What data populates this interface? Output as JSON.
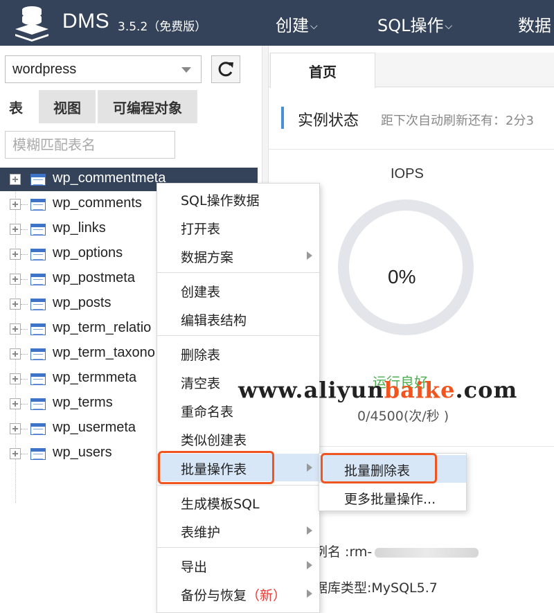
{
  "header": {
    "app_name": "DMS",
    "version": "3.5.2（免费版）",
    "nav": [
      {
        "label": "创建"
      },
      {
        "label": "SQL操作"
      },
      {
        "label": "数据"
      }
    ]
  },
  "left_panel": {
    "database": "wordpress",
    "tabs": [
      {
        "label": "表"
      },
      {
        "label": "视图"
      },
      {
        "label": "可编程对象"
      }
    ],
    "filter_placeholder": "模糊匹配表名",
    "tables": [
      {
        "name": "wp_commentmeta"
      },
      {
        "name": "wp_comments"
      },
      {
        "name": "wp_links"
      },
      {
        "name": "wp_options"
      },
      {
        "name": "wp_postmeta"
      },
      {
        "name": "wp_posts"
      },
      {
        "name": "wp_term_relatio"
      },
      {
        "name": "wp_term_taxono"
      },
      {
        "name": "wp_termmeta"
      },
      {
        "name": "wp_terms"
      },
      {
        "name": "wp_usermeta"
      },
      {
        "name": "wp_users"
      }
    ]
  },
  "right_panel": {
    "tab": "首页",
    "section_title": "实例状态",
    "refresh_text": "距下次自动刷新还有：2分3",
    "iops_label": "IOPS",
    "iops_percent": "0%",
    "iops_fraction": 0.0,
    "status": "运行良好",
    "rate": "0/4500(次/秒 )",
    "instance_name_prefix": "例名 :rm-",
    "db_type": "据库类型:MySQL5.7"
  },
  "context_menu": {
    "items": [
      {
        "label": "SQL操作数据"
      },
      {
        "label": "打开表"
      },
      {
        "label": "数据方案"
      },
      {
        "label": "创建表"
      },
      {
        "label": "编辑表结构"
      },
      {
        "label": "删除表"
      },
      {
        "label": "清空表"
      },
      {
        "label": "重命名表"
      },
      {
        "label": "类似创建表"
      },
      {
        "label": "批量操作表"
      },
      {
        "label": "生成模板SQL"
      },
      {
        "label": "表维护"
      },
      {
        "label": "导出"
      },
      {
        "label": "备份与恢复",
        "tag": "（新）"
      }
    ]
  },
  "submenu": {
    "items": [
      {
        "label": "批量删除表"
      },
      {
        "label": "更多批量操作..."
      }
    ]
  },
  "watermark": {
    "part1": "www.aliyun",
    "part2": "baike",
    "part3": ".com"
  },
  "colors": {
    "header_bg": "#34435a",
    "highlight": "#f0551f",
    "accent_blue": "#4a90d9",
    "status_green": "#4caf50"
  }
}
